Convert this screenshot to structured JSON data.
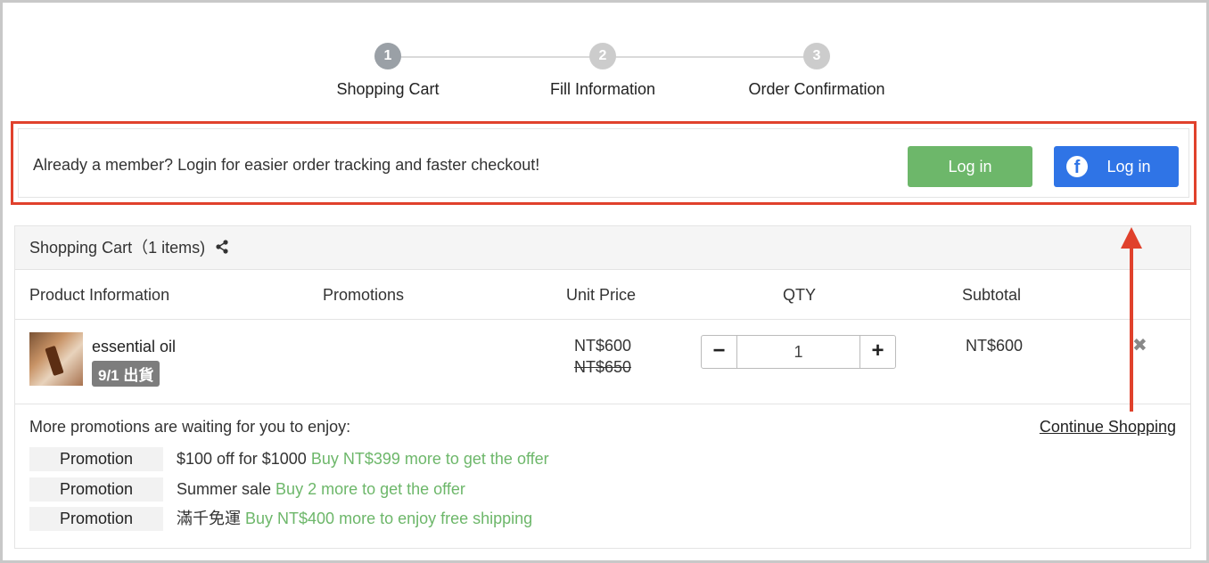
{
  "steps": [
    {
      "num": "1",
      "label": "Shopping Cart"
    },
    {
      "num": "2",
      "label": "Fill Information"
    },
    {
      "num": "3",
      "label": "Order Confirmation"
    }
  ],
  "member": {
    "message": "Already a member? Login for easier order tracking and faster checkout!",
    "login_label": "Log in",
    "fb_login_label": "Log in",
    "fb_icon": "facebook-icon"
  },
  "cart": {
    "title": "Shopping Cart（1 items)",
    "share_icon": "share-icon",
    "columns": {
      "product": "Product Information",
      "promotions": "Promotions",
      "unit_price": "Unit Price",
      "qty": "QTY",
      "subtotal": "Subtotal"
    },
    "items": [
      {
        "name": "essential oil",
        "tag": "9/1 出貨",
        "price": "NT$600",
        "original_price": "NT$650",
        "qty": "1",
        "subtotal": "NT$600",
        "remove_icon": "close-icon"
      }
    ]
  },
  "promotions": {
    "title": "More promotions are waiting for you to enjoy:",
    "continue_label": "Continue Shopping",
    "list": [
      {
        "badge": "Promotion",
        "text": "$100 off for $1000",
        "highlight": "Buy NT$399 more to get the offer"
      },
      {
        "badge": "Promotion",
        "text": "Summer sale",
        "highlight": "Buy 2 more to get the offer"
      },
      {
        "badge": "Promotion",
        "text": "滿千免運",
        "highlight": "Buy NT$400 more to enjoy free shipping"
      }
    ]
  },
  "colors": {
    "highlight_border": "#e0412c",
    "login_green": "#6db76a",
    "facebook_blue": "#2f74e6",
    "promo_green": "#6db76a"
  }
}
